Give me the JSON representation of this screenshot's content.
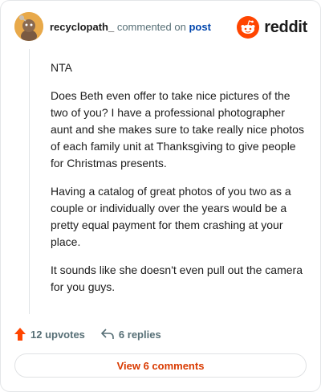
{
  "comment": {
    "username": "recyclopath_",
    "action_text": "commented on",
    "post_link": "post",
    "paragraphs": [
      "NTA",
      "Does Beth even offer to take nice pictures of the two of you? I have a professional photographer aunt and she makes sure to take really nice photos of each family unit at Thanksgiving to give people for Christmas presents.",
      "Having a catalog of great photos of you two as a couple or individually over the years would be a pretty equal payment for them crashing at your place.",
      "It sounds like she doesn't even pull out the camera for you guys."
    ]
  },
  "brand": {
    "wordmark": "reddit",
    "color": "#ff4500"
  },
  "actions": {
    "upvotes": "12 upvotes",
    "replies": "6 replies"
  },
  "view_comments_label": "View 6 comments",
  "colors": {
    "accent": "#d93a00",
    "upvote": "#ff4500",
    "link": "#0045ac"
  },
  "icons": [
    "avatar-snoo-icon",
    "reddit-snoo-icon",
    "upvote-arrow-icon",
    "reply-arrow-icon"
  ]
}
